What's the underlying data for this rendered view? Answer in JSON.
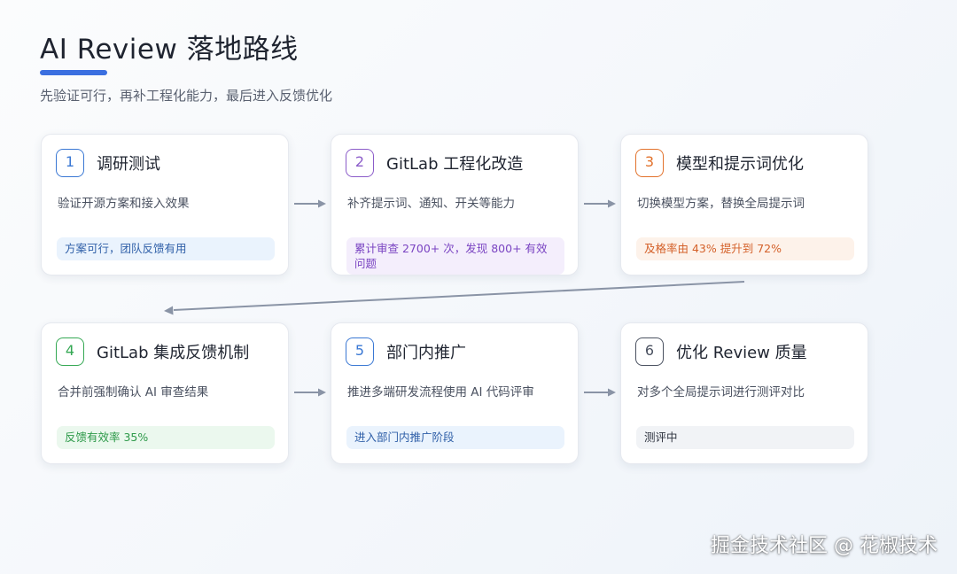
{
  "header": {
    "title": "AI Review 落地路线",
    "subtitle": "先验证可行，再补工程化能力，最后进入反馈优化",
    "accent": "#3b6fe0"
  },
  "steps": [
    {
      "num": "1",
      "title": "调研测试",
      "desc": "验证开源方案和接入效果",
      "badge": "方案可行，团队反馈有用",
      "color": "#3a78d4",
      "badge_bg": "#eaf3fd",
      "badge_fg": "#2f5fa8"
    },
    {
      "num": "2",
      "title": "GitLab 工程化改造",
      "desc": "补齐提示词、通知、开关等能力",
      "badge": "累计审查 2700+ 次，发现 800+ 有效问题",
      "color": "#8b5cc9",
      "badge_bg": "#f4eefc",
      "badge_fg": "#7a44c2"
    },
    {
      "num": "3",
      "title": "模型和提示词优化",
      "desc": "切换模型方案，替换全局提示词",
      "badge": "及格率由 43% 提升到 72%",
      "color": "#e2722c",
      "badge_bg": "#fdf2ea",
      "badge_fg": "#d4612a"
    },
    {
      "num": "4",
      "title": "GitLab 集成反馈机制",
      "desc": "合并前强制确认 AI 审查结果",
      "badge": "反馈有效率 35%",
      "color": "#34a853",
      "badge_bg": "#ebf8ee",
      "badge_fg": "#2e9a4a"
    },
    {
      "num": "5",
      "title": "部门内推广",
      "desc": "推进多端研发流程使用 AI 代码评审",
      "badge": "进入部门内推广阶段",
      "color": "#3a78d4",
      "badge_bg": "#eaf3fd",
      "badge_fg": "#2f5fa8"
    },
    {
      "num": "6",
      "title": "优化 Review 质量",
      "desc": "对多个全局提示词进行测评对比",
      "badge": "测评中",
      "color": "#4a5160",
      "badge_bg": "#f1f3f6",
      "badge_fg": "#2f3440"
    }
  ],
  "watermark": "掘金技术社区 @ 花椒技术"
}
